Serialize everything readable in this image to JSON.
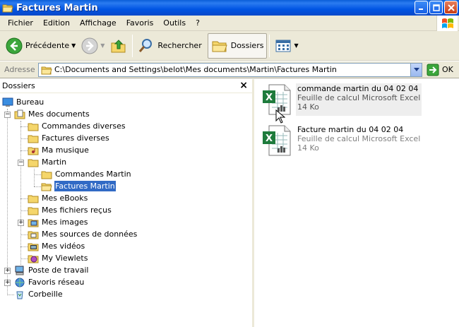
{
  "window": {
    "title": "Factures Martin"
  },
  "menu": [
    "Fichier",
    "Edition",
    "Affichage",
    "Favoris",
    "Outils",
    "?"
  ],
  "toolbar": {
    "back_label": "Précédente",
    "search_label": "Rechercher",
    "folders_label": "Dossiers"
  },
  "address": {
    "label": "Adresse",
    "value": "C:\\Documents and Settings\\belot\\Mes documents\\Martin\\Factures Martin",
    "go_label": "OK"
  },
  "folders_pane": {
    "title": "Dossiers",
    "items": [
      {
        "label": "Bureau",
        "icon": "desktop-icon"
      },
      {
        "label": "Mes documents",
        "icon": "my-documents-icon"
      },
      {
        "label": "Commandes diverses",
        "icon": "folder-icon"
      },
      {
        "label": "Factures diverses",
        "icon": "folder-icon"
      },
      {
        "label": "Ma musique",
        "icon": "music-folder-icon"
      },
      {
        "label": "Martin",
        "icon": "folder-icon"
      },
      {
        "label": "Commandes Martin",
        "icon": "folder-icon"
      },
      {
        "label": "Factures Martin",
        "icon": "folder-open-icon"
      },
      {
        "label": "Mes eBooks",
        "icon": "folder-icon"
      },
      {
        "label": "Mes fichiers reçus",
        "icon": "folder-icon"
      },
      {
        "label": "Mes images",
        "icon": "pictures-folder-icon"
      },
      {
        "label": "Mes sources de données",
        "icon": "data-sources-folder-icon"
      },
      {
        "label": "Mes vidéos",
        "icon": "videos-folder-icon"
      },
      {
        "label": "My Viewlets",
        "icon": "viewlets-folder-icon"
      },
      {
        "label": "Poste de travail",
        "icon": "my-computer-icon"
      },
      {
        "label": "Favoris réseau",
        "icon": "network-places-icon"
      },
      {
        "label": "Corbeille",
        "icon": "recycle-bin-icon"
      }
    ]
  },
  "files": [
    {
      "name": "commande martin du 04 02 04",
      "type": "Feuille de calcul Microsoft Excel",
      "size": "14 Ko"
    },
    {
      "name": "Facture martin du 04 02 04",
      "type": "Feuille de calcul Microsoft Excel",
      "size": "14 Ko"
    }
  ],
  "colors": {
    "titlebar": "#0054e3",
    "selection": "#316ac5",
    "chrome": "#ece9d8"
  }
}
